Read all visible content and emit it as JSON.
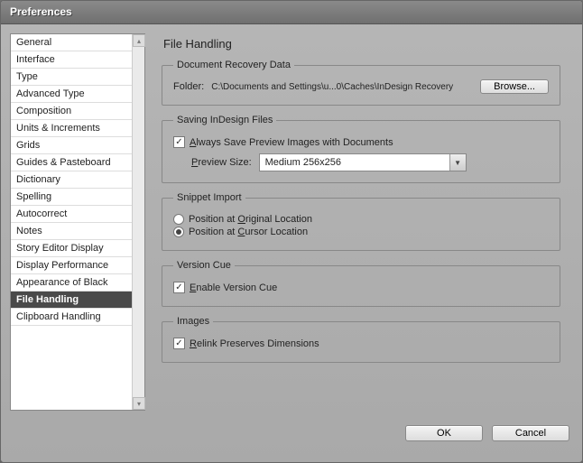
{
  "window": {
    "title": "Preferences"
  },
  "sidebar": {
    "items": [
      "General",
      "Interface",
      "Type",
      "Advanced Type",
      "Composition",
      "Units & Increments",
      "Grids",
      "Guides & Pasteboard",
      "Dictionary",
      "Spelling",
      "Autocorrect",
      "Notes",
      "Story Editor Display",
      "Display Performance",
      "Appearance of Black",
      "File Handling",
      "Clipboard Handling"
    ],
    "selected_index": 15
  },
  "page": {
    "heading": "File Handling"
  },
  "recovery": {
    "legend": "Document Recovery Data",
    "folder_label": "Folder:",
    "folder_path": "C:\\Documents and Settings\\u...0\\Caches\\InDesign Recovery",
    "browse": "Browse..."
  },
  "saving": {
    "legend": "Saving InDesign Files",
    "always_save_preview_prefix": "A",
    "always_save_preview_rest": "lways Save Preview Images with Documents",
    "preview_label_prefix": "P",
    "preview_label_rest": "review Size:",
    "preview_value": "Medium 256x256"
  },
  "snippet": {
    "legend": "Snippet Import",
    "opt1_pre": "Position at ",
    "opt1_u": "O",
    "opt1_post": "riginal Location",
    "opt2_pre": "Position at ",
    "opt2_u": "C",
    "opt2_post": "ursor Location",
    "selected": 1
  },
  "versioncue": {
    "legend": "Version Cue",
    "enable_u": "E",
    "enable_rest": "nable Version Cue"
  },
  "images": {
    "legend": "Images",
    "relink_u": "R",
    "relink_rest": "elink Preserves Dimensions"
  },
  "footer": {
    "ok": "OK",
    "cancel": "Cancel"
  }
}
